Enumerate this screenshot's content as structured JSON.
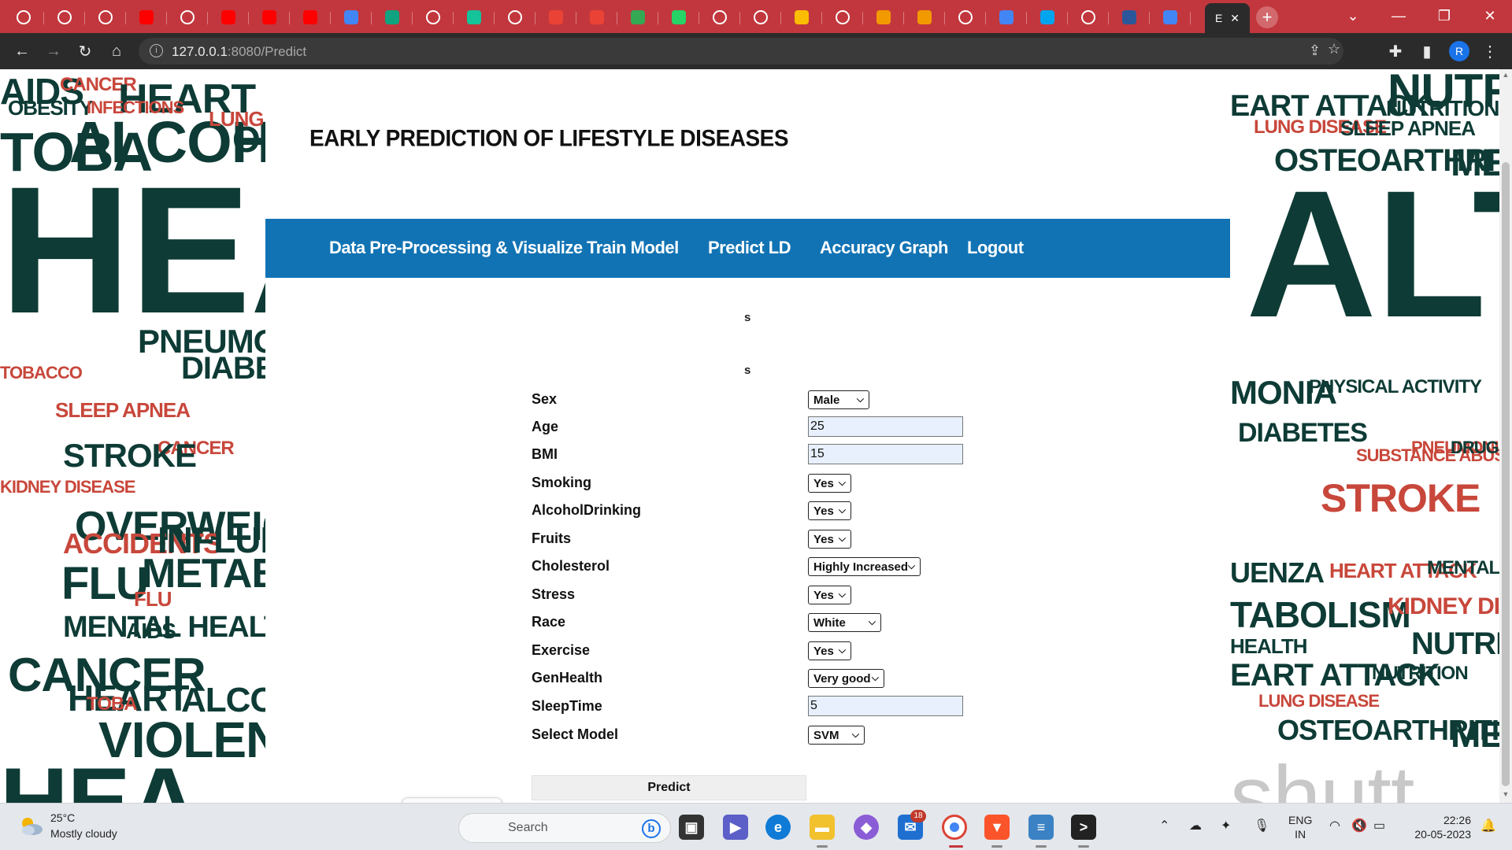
{
  "browser": {
    "active_tab_title": "E",
    "url_host": "127.0.0.1",
    "url_rest": ":8080/Predict",
    "profile_initial": "R",
    "tab_favicons": [
      "chrome-tab",
      "chrome-tab",
      "chrome-tab",
      "youtube",
      "chrome-tab",
      "youtube",
      "youtube",
      "youtube",
      "docs",
      "chatgpt",
      "chrome-tab",
      "grammarly",
      "chrome-tab",
      "gmail",
      "gmail",
      "mail",
      "whatsapp",
      "chrome-tab",
      "chrome-tab",
      "drive",
      "chrome-tab",
      "link",
      "link",
      "chrome-tab",
      "docs",
      "microsoft",
      "chrome-tab",
      "word",
      "docs"
    ]
  },
  "site": {
    "title": "EARLY PREDICTION OF LIFESTYLE DISEASES",
    "nav": [
      "Data Pre-Processing & Visualize",
      "Train Model",
      "Predict LD",
      "Accuracy Graph",
      "Logout"
    ],
    "marker_1": "s",
    "marker_2": "s"
  },
  "form": {
    "fields": [
      {
        "label": "Sex",
        "type": "select",
        "value": "Male"
      },
      {
        "label": "Age",
        "type": "input",
        "value": "25"
      },
      {
        "label": "BMI",
        "type": "input",
        "value": "15"
      },
      {
        "label": "Smoking",
        "type": "select",
        "value": "Yes"
      },
      {
        "label": "AlcoholDrinking",
        "type": "select",
        "value": "Yes"
      },
      {
        "label": "Fruits",
        "type": "select",
        "value": "Yes"
      },
      {
        "label": "Cholesterol",
        "type": "select",
        "value": "Highly Increased"
      },
      {
        "label": "Stress",
        "type": "select",
        "value": "Yes"
      },
      {
        "label": "Race",
        "type": "select",
        "value": "White"
      },
      {
        "label": "Exercise",
        "type": "select",
        "value": "Yes"
      },
      {
        "label": "GenHealth",
        "type": "select",
        "value": "Very good"
      },
      {
        "label": "SleepTime",
        "type": "input",
        "value": "5"
      },
      {
        "label": "Select Model",
        "type": "select",
        "value": "SVM"
      }
    ],
    "submit_label": "Predict"
  },
  "background_words": {
    "left": [
      "AIDS",
      "CANCER",
      "HEART",
      "OBESITY",
      "INFECTIONS",
      "TOBA",
      "ALCOHOL",
      "LUNG",
      "OST",
      "HEA",
      "PNEUMONIA",
      "TOBACCO",
      "DIABETES",
      "SLEEP APNEA",
      "CANCER",
      "STROKE",
      "KIDNEY DISEASE",
      "OVERWEIGHT",
      "ACCIDENTS",
      "INFLUENZA",
      "FLU",
      "METABOL",
      "FLU",
      "MENTAL HEALTH",
      "AIDS",
      "CANCER",
      "HEART",
      "TOBA",
      "ALCOHOL",
      "VIOLENCE",
      "HEA"
    ],
    "right": [
      "NUTRI",
      "EART ATTACK",
      "NUTRITION",
      "LUNG DISEASE",
      "SLEEP APNEA",
      "OSTEOARTHRITIS",
      "MEN",
      "ALT",
      "MONIA",
      "PHYSICAL ACTIVITY",
      "DIABETES",
      "STROKE",
      "SUBSTANCE ABUSE",
      "PNEUMONIA",
      "DRUGS",
      "UENZA",
      "HEART ATTACK",
      "MENTAL",
      "TABOLISM",
      "KIDNEY DISEA",
      "NUTRI",
      "HEALTH",
      "EART ATTACK",
      "NUTRITION",
      "LUNG DISEASE",
      "OSTEOARTHRITIS",
      "MEN",
      "shutt"
    ]
  },
  "voice_bar": {
    "items": [
      "cursor-icon",
      "mic-icon",
      "more-icon"
    ]
  },
  "taskbar": {
    "temperature": "25°C",
    "weather": "Mostly cloudy",
    "search_placeholder": "Search",
    "mail_badge": "18",
    "lang_line1": "ENG",
    "lang_line2": "IN",
    "time": "22:26",
    "date": "20-05-2023"
  },
  "colors": {
    "tabbar": "#c2373d",
    "toolbar": "#2b2b2b",
    "navbar": "#1173b4",
    "input_bg": "#e8f0fe",
    "word_dark": "#0e3b35",
    "word_red": "#c8473b"
  }
}
